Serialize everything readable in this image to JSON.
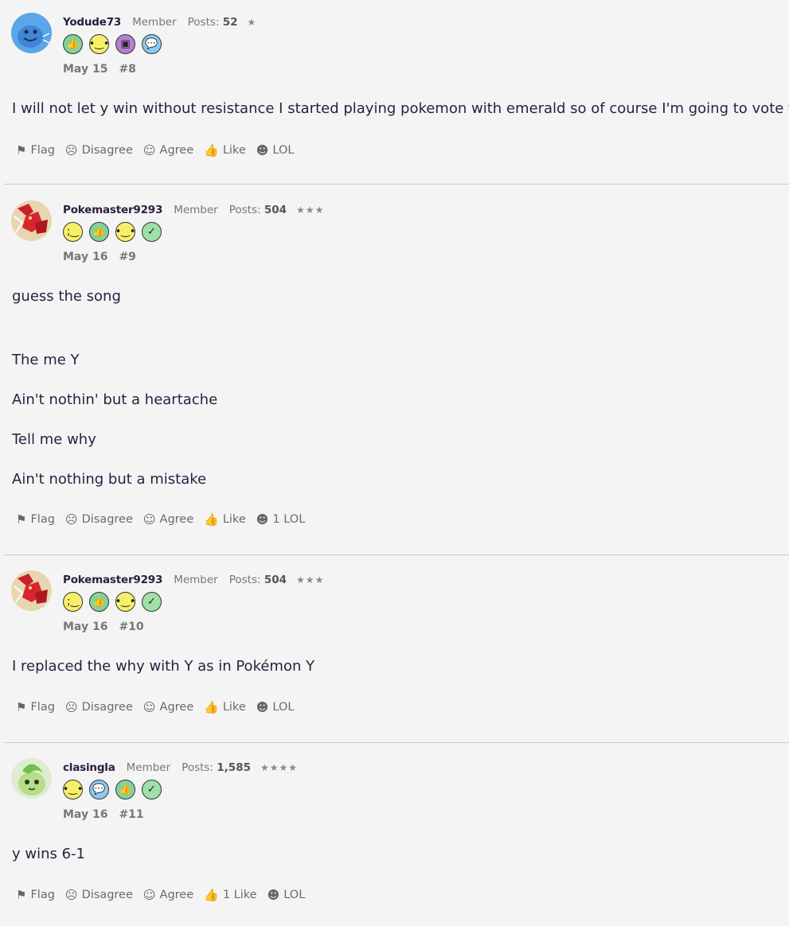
{
  "posts": [
    {
      "username": "Yodude73",
      "role": "Member",
      "posts_label": "Posts:",
      "posts_count": "52",
      "stars": "★",
      "date": "May 15",
      "number": "#8",
      "content": [
        "I will not let y win without resistance I started playing pokemon with emerald so of course I'm going to vote for it"
      ],
      "actions": {
        "flag": "Flag",
        "disagree": "Disagree",
        "agree": "Agree",
        "like": "Like",
        "lol": "LOL"
      }
    },
    {
      "username": "Pokemaster9293",
      "role": "Member",
      "posts_label": "Posts:",
      "posts_count": "504",
      "stars": "★★★",
      "date": "May 16",
      "number": "#9",
      "content": [
        "guess the song",
        "The me Y",
        "Ain't nothin' but a heartache",
        "Tell me why",
        "Ain't nothing but a mistake"
      ],
      "actions": {
        "flag": "Flag",
        "disagree": "Disagree",
        "agree": "Agree",
        "like": "Like",
        "lol": "1 LOL"
      }
    },
    {
      "username": "Pokemaster9293",
      "role": "Member",
      "posts_label": "Posts:",
      "posts_count": "504",
      "stars": "★★★",
      "date": "May 16",
      "number": "#10",
      "content": [
        "I replaced the why with Y as in Pokémon Y"
      ],
      "actions": {
        "flag": "Flag",
        "disagree": "Disagree",
        "agree": "Agree",
        "like": "Like",
        "lol": "LOL"
      }
    },
    {
      "username": "clasingla",
      "role": "Member",
      "posts_label": "Posts:",
      "posts_count": "1,585",
      "stars": "★★★★",
      "date": "May 16",
      "number": "#11",
      "content": [
        "y wins 6-1"
      ],
      "actions": {
        "flag": "Flag",
        "disagree": "Disagree",
        "agree": "Agree",
        "like": "1 Like",
        "lol": "LOL"
      }
    }
  ],
  "colors": {
    "text": "#2b1e3f",
    "muted": "#777777",
    "badge_green": "#7fd49a",
    "badge_yellow": "#f7ef6a",
    "badge_purple": "#b57fd0",
    "badge_blue": "#8fc9f2"
  }
}
